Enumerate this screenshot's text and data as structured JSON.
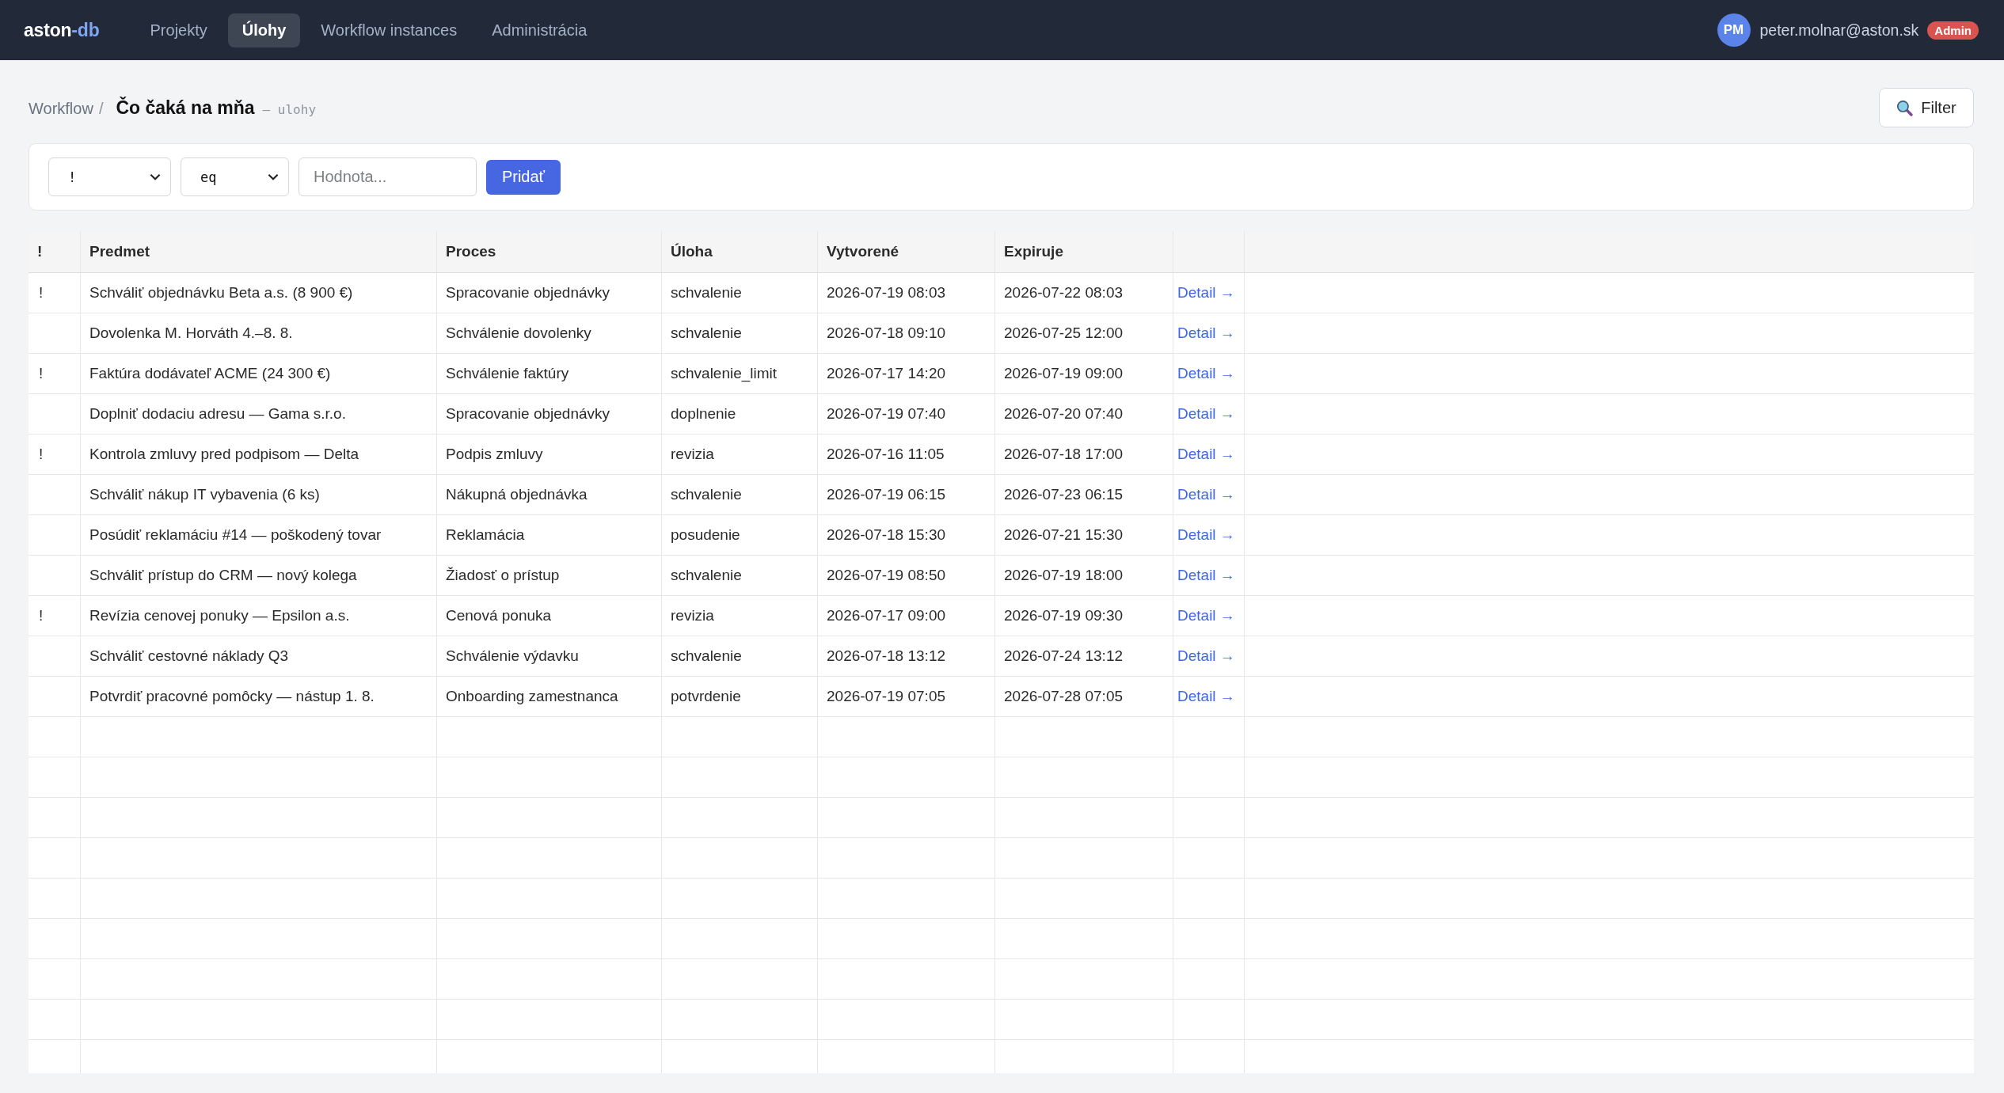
{
  "nav": {
    "logo": {
      "text": "aston",
      "accent": "-db"
    },
    "items": [
      {
        "label": "Projekty",
        "selected": false
      },
      {
        "label": "Úlohy",
        "selected": true
      },
      {
        "label": "Workflow instances",
        "selected": false
      },
      {
        "label": "Administrácia",
        "selected": false
      }
    ],
    "user": {
      "initials": "PM",
      "email": "peter.molnar@aston.sk",
      "role": "Admin"
    }
  },
  "breadcrumb": {
    "parent": "Workflow",
    "separator": "/",
    "current": "Čo čaká na mňa",
    "subtitle": "— ulohy"
  },
  "filter_button": {
    "label": "Filter"
  },
  "filter_bar": {
    "field": "!",
    "operator": "eq",
    "value": {
      "placeholder": "Hodnota..."
    },
    "add_button": "Pridať"
  },
  "table": {
    "columns": [
      "!",
      "Predmet",
      "Proces",
      "Úloha",
      "Vytvorené",
      "Expiruje"
    ],
    "rows": [
      {
        "flag": "!",
        "subject": "Schváliť objednávku Beta a.s. (8 900 €)",
        "process": "Spracovanie objednávky",
        "task": "schvalenie",
        "created": "2026-07-19 08:03",
        "expires": "2026-07-22 08:03",
        "action": "Detail →"
      },
      {
        "subject": "Dovolenka M. Horváth 4.–8. 8.",
        "process": "Schválenie dovolenky",
        "task": "schvalenie",
        "created": "2026-07-18 09:10",
        "expires": "2026-07-25 12:00",
        "action": "Detail →"
      },
      {
        "flag": "!",
        "subject": "Faktúra dodávateľ ACME (24 300 €)",
        "process": "Schválenie faktúry",
        "task": "schvalenie_limit",
        "created": "2026-07-17 14:20",
        "expires": "2026-07-19 09:00",
        "action": "Detail →"
      },
      {
        "subject": "Doplniť dodaciu adresu — Gama s.r.o.",
        "process": "Spracovanie objednávky",
        "task": "doplnenie",
        "created": "2026-07-19 07:40",
        "expires": "2026-07-20 07:40",
        "action": "Detail →"
      },
      {
        "flag": "!",
        "subject": "Kontrola zmluvy pred podpisom — Delta",
        "process": "Podpis zmluvy",
        "task": "revizia",
        "created": "2026-07-16 11:05",
        "expires": "2026-07-18 17:00",
        "action": "Detail →"
      },
      {
        "subject": "Schváliť nákup IT vybavenia (6 ks)",
        "process": "Nákupná objednávka",
        "task": "schvalenie",
        "created": "2026-07-19 06:15",
        "expires": "2026-07-23 06:15",
        "action": "Detail →"
      },
      {
        "subject": "Posúdiť reklamáciu #14 — poškodený tovar",
        "process": "Reklamácia",
        "task": "posudenie",
        "created": "2026-07-18 15:30",
        "expires": "2026-07-21 15:30",
        "action": "Detail →"
      },
      {
        "subject": "Schváliť prístup do CRM — nový kolega",
        "process": "Žiadosť o prístup",
        "task": "schvalenie",
        "created": "2026-07-19 08:50",
        "expires": "2026-07-19 18:00",
        "action": "Detail →"
      },
      {
        "flag": "!",
        "subject": "Revízia cenovej ponuky — Epsilon a.s.",
        "process": "Cenová ponuka",
        "task": "revizia",
        "created": "2026-07-17 09:00",
        "expires": "2026-07-19 09:30",
        "action": "Detail →"
      },
      {
        "subject": "Schváliť cestovné náklady Q3",
        "process": "Schválenie výdavku",
        "task": "schvalenie",
        "created": "2026-07-18 13:12",
        "expires": "2026-07-24 13:12",
        "action": "Detail →"
      },
      {
        "subject": "Potvrdiť pracovné pomôcky — nástup 1. 8.",
        "process": "Onboarding zamestnanca",
        "task": "potvrdenie",
        "created": "2026-07-19 07:05",
        "expires": "2026-07-28 07:05",
        "action": "Detail →"
      }
    ]
  }
}
